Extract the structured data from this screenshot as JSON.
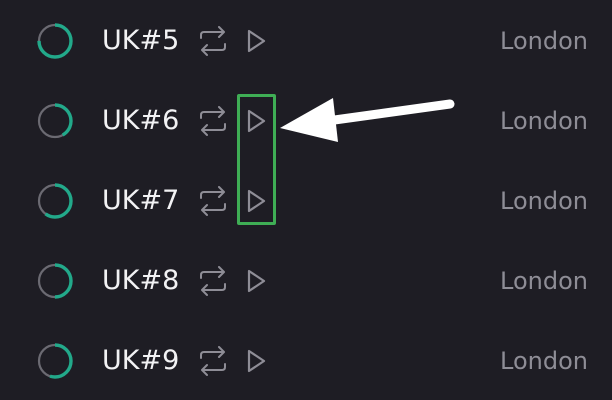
{
  "servers": [
    {
      "name": "UK#5",
      "location": "London",
      "load_fraction": 0.75
    },
    {
      "name": "UK#6",
      "location": "London",
      "load_fraction": 0.42
    },
    {
      "name": "UK#7",
      "location": "London",
      "load_fraction": 0.6
    },
    {
      "name": "UK#8",
      "location": "London",
      "load_fraction": 0.5
    },
    {
      "name": "UK#9",
      "location": "London",
      "load_fraction": 0.55
    }
  ],
  "icons": {
    "load": "load-ring-icon",
    "reconnect": "swap-arrows-icon",
    "connect": "play-triangle-icon"
  },
  "colors": {
    "background": "#1e1d24",
    "load_ring": "#22a98a",
    "load_track": "#6b6a72",
    "annotation_box": "#3fae55",
    "annotation_arrow": "#ffffff"
  }
}
